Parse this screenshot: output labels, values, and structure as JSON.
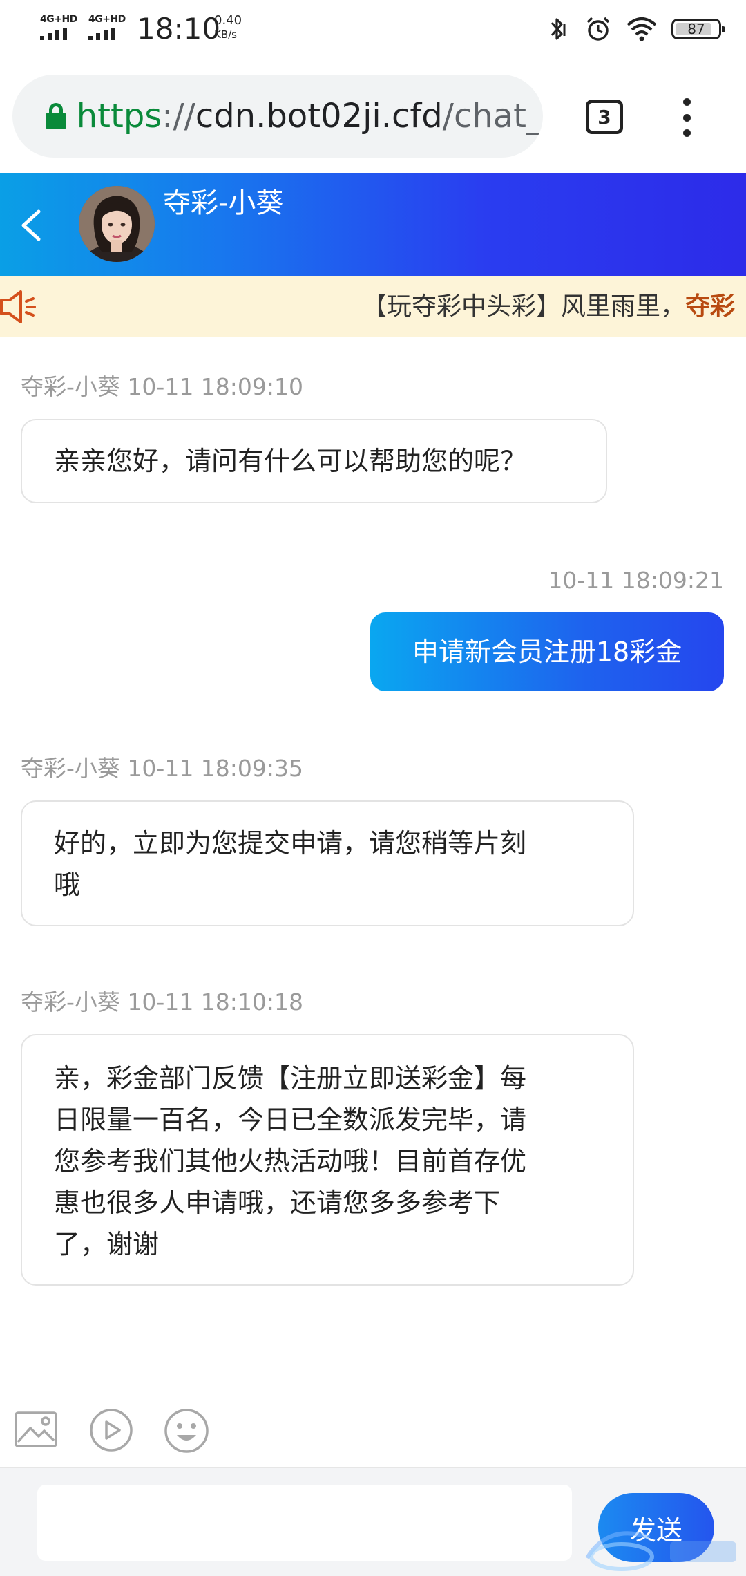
{
  "status_bar": {
    "network_1": "4G+HD",
    "network_2": "4G+HD",
    "time": "18:10",
    "speed_value": "0.40",
    "speed_unit": "KB/s",
    "battery": "87",
    "icons": [
      "bluetooth-icon",
      "alarm-icon",
      "wifi-icon",
      "battery-icon"
    ]
  },
  "browser": {
    "url_scheme": "https",
    "url_sep": "://",
    "url_host": "cdn.bot02ji.cfd",
    "url_path": "/chat_",
    "tab_count": "3"
  },
  "chat_header": {
    "title": "夺彩-小葵",
    "gradient_colors": [
      "#0a9fe6",
      "#2d2be9"
    ]
  },
  "notice": {
    "text_prefix": "【玩夺彩中头彩】风里雨里，",
    "text_highlight": "夺彩"
  },
  "messages": [
    {
      "direction": "in",
      "sender": "夺彩-小葵",
      "time": "10-11 18:09:10",
      "text": "亲亲您好，请问有什么可以帮助您的呢？"
    },
    {
      "direction": "out",
      "time": "10-11 18:09:21",
      "text": "申请新会员注册18彩金"
    },
    {
      "direction": "in",
      "sender": "夺彩-小葵",
      "time": "10-11 18:09:35",
      "lines": [
        "好的，立即为您提交申请，请您稍等片刻",
        "哦"
      ]
    },
    {
      "direction": "in",
      "sender": "夺彩-小葵",
      "time": "10-11 18:10:18",
      "lines": [
        "亲，彩金部门反馈【注册立即送彩金】每",
        "日限量一百名，今日已全数派发完毕，请",
        "您参考我们其他火热活动哦！目前首存优",
        "惠也很多人申请哦，还请您多多参考下",
        "了，谢谢"
      ]
    }
  ],
  "toolbar": {
    "icons": [
      "image-icon",
      "video-icon",
      "emoji-icon"
    ]
  },
  "composer": {
    "input_value": "",
    "send_label": "发送"
  },
  "accent_colors": {
    "secure_green": "#0a8a3a",
    "notice_bg": "#fdf4d8",
    "notice_highlight": "#b84a10"
  }
}
